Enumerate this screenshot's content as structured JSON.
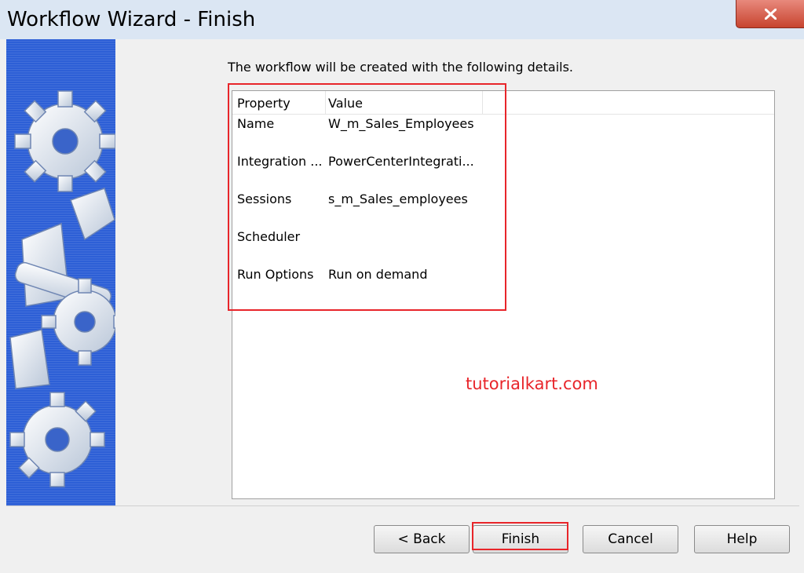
{
  "window": {
    "title": "Workflow Wizard - Finish"
  },
  "intro": "The workflow will be created with the following details.",
  "details": {
    "columns": [
      "Property",
      "Value"
    ],
    "rows": [
      {
        "property": "Name",
        "value": "W_m_Sales_Employees"
      },
      {
        "property": "Integration ...",
        "value": "PowerCenterIntegrati..."
      },
      {
        "property": "Sessions",
        "value": "s_m_Sales_employees"
      },
      {
        "property": "Scheduler",
        "value": ""
      },
      {
        "property": "Run Options",
        "value": "Run on demand"
      }
    ]
  },
  "watermark": "tutorialkart.com",
  "buttons": {
    "back": "< Back",
    "finish": "Finish",
    "cancel": "Cancel",
    "help": "Help"
  },
  "colors": {
    "banner": "#2d5fd6",
    "highlight": "#e8252a",
    "close": "#c7442f"
  }
}
